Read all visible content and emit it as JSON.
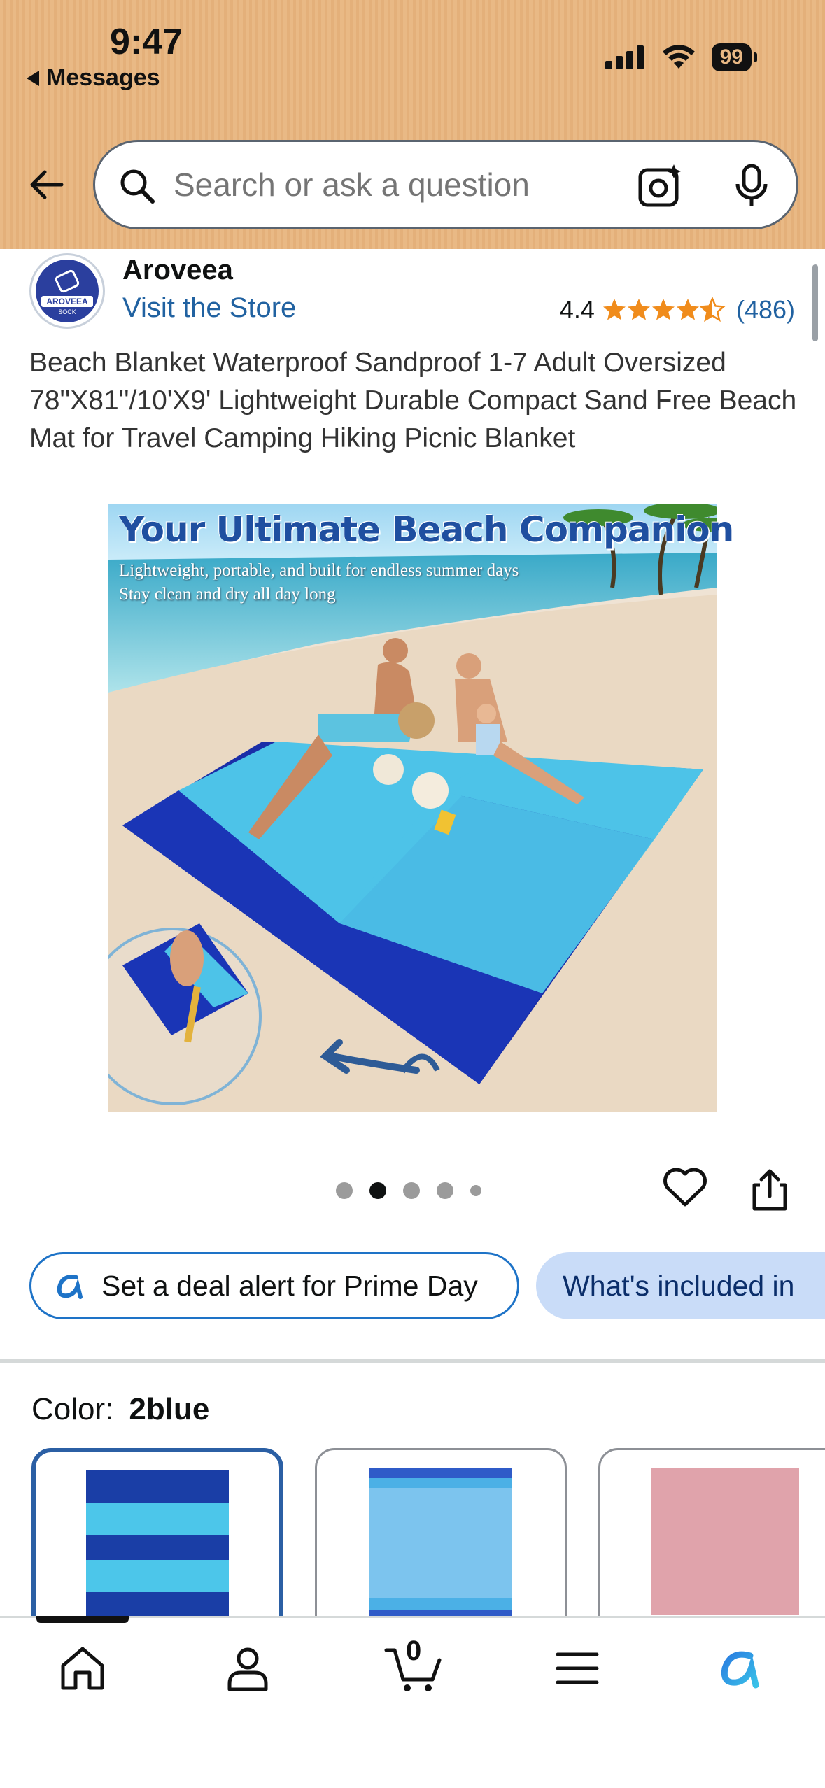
{
  "status_bar": {
    "time": "9:47",
    "back_app": "Messages",
    "battery": "99"
  },
  "search": {
    "placeholder": "Search or ask a question"
  },
  "brand": {
    "name": "Aroveea",
    "logo_text": "AROVEEA",
    "logo_sub": "SOCK",
    "visit_store": "Visit the Store"
  },
  "rating": {
    "value": "4.4",
    "stars": 4.4,
    "count": "(486)"
  },
  "product": {
    "title": "Beach Blanket Waterproof Sandproof 1-7 Adult Oversized 78''X81''/10'X9' Lightweight Durable Compact Sand Free Beach Mat for Travel Camping Hiking Picnic Blanket",
    "image_headline": "Your Ultimate Beach Companion",
    "image_line1": "Lightweight, portable, and built for endless summer days",
    "image_line2": "Stay clean and dry all day long"
  },
  "carousel": {
    "active_index": 1,
    "count": 5
  },
  "chips": {
    "deal_alert": "Set a deal alert for Prime Day",
    "whats_included": "What's included in"
  },
  "color": {
    "label": "Color:",
    "selected": "2blue"
  },
  "swatches": [
    {
      "name": "2blue",
      "colors": [
        "#1a3ea6",
        "#4cc6ea"
      ]
    },
    {
      "name": "light blue",
      "colors": [
        "#7cc4ee",
        "#2f5bc8"
      ]
    },
    {
      "name": "pink",
      "colors": [
        "#e0a3ab"
      ]
    }
  ],
  "bottom_nav": {
    "cart_count": "0",
    "items": [
      "home",
      "account",
      "cart",
      "menu",
      "rufus"
    ]
  },
  "colors": {
    "header_bg": "#e9b985",
    "link": "#2162a1",
    "star": "#f08c1c",
    "chip_border": "#1e73c7",
    "chip_bg": "#c9dcf8"
  }
}
